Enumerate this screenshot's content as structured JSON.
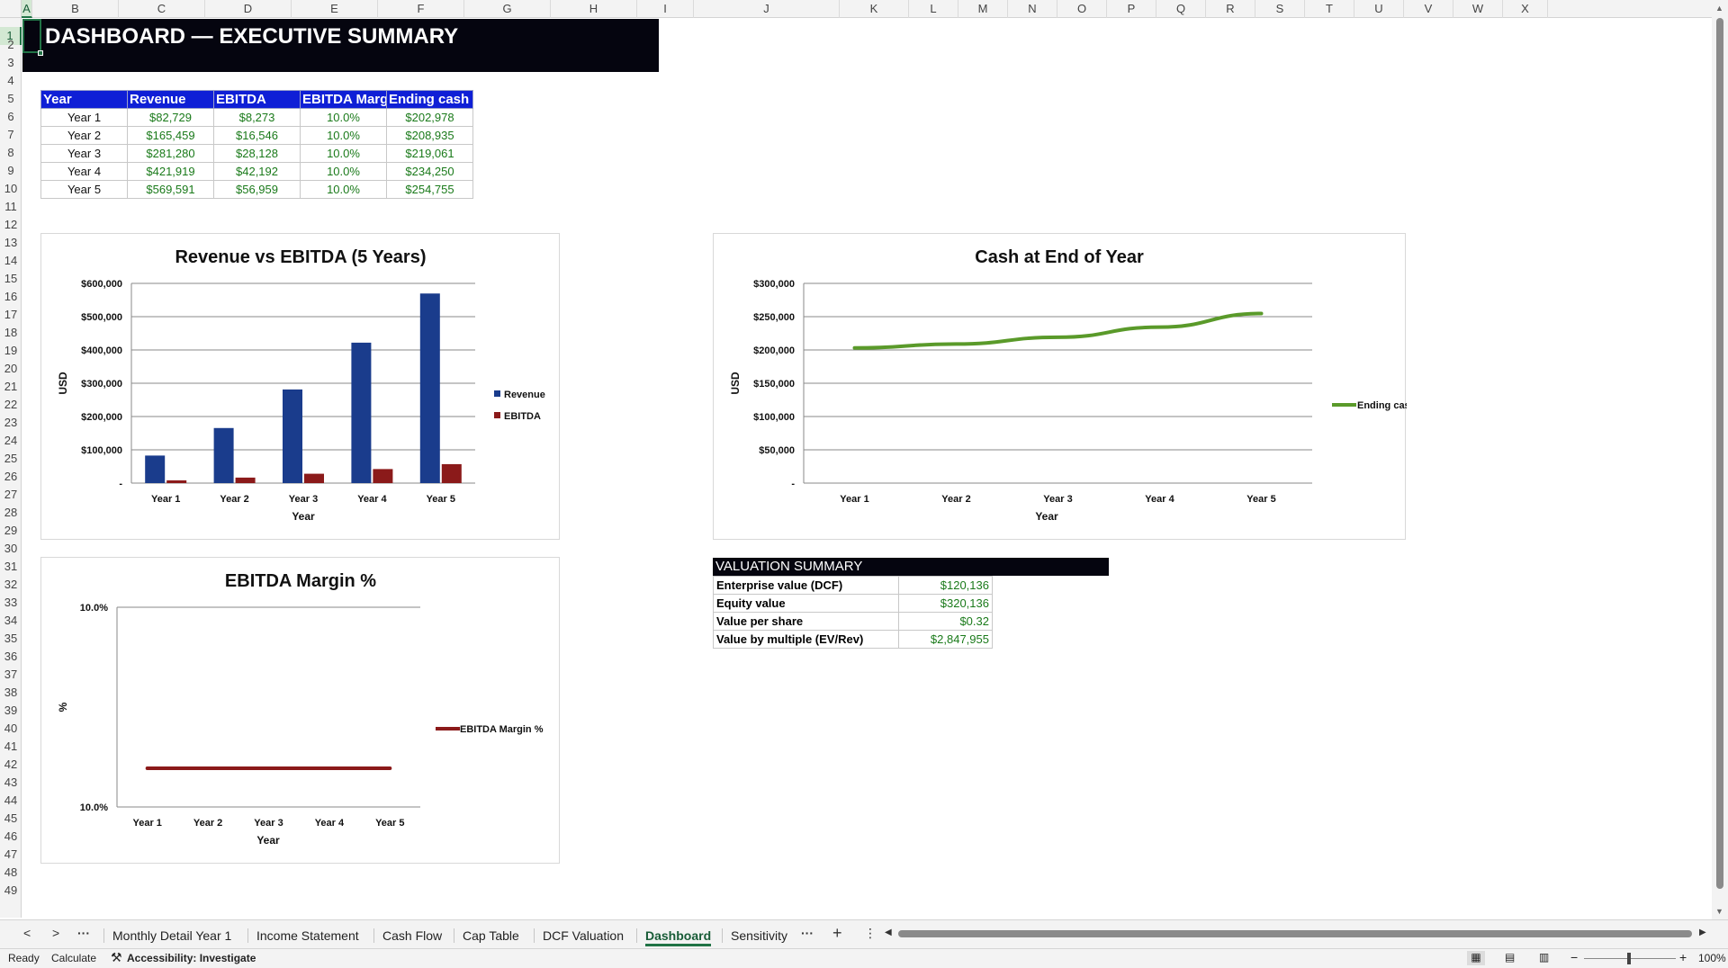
{
  "columns": [
    "A",
    "B",
    "C",
    "D",
    "E",
    "F",
    "G",
    "H",
    "I",
    "J",
    "K",
    "L",
    "M",
    "N",
    "O",
    "P",
    "Q",
    "R",
    "S",
    "T",
    "U",
    "V",
    "W",
    "X"
  ],
  "rows": [
    "1",
    "2",
    "3",
    "4",
    "5",
    "6",
    "7",
    "8",
    "9",
    "10",
    "11",
    "12",
    "13",
    "14",
    "15",
    "16",
    "17",
    "18",
    "19",
    "20",
    "21",
    "22",
    "23",
    "24",
    "25",
    "26",
    "27",
    "28",
    "29",
    "30",
    "31",
    "32",
    "33",
    "34",
    "35",
    "36",
    "37",
    "38",
    "39",
    "40",
    "41",
    "42",
    "43",
    "44",
    "45",
    "46",
    "47",
    "48",
    "49"
  ],
  "title": "DASHBOARD — EXECUTIVE SUMMARY",
  "table": {
    "headers": [
      "Year",
      "Revenue",
      "EBITDA",
      "EBITDA Marg",
      "Ending cash"
    ],
    "rows": [
      [
        "Year 1",
        "$82,729",
        "$8,273",
        "10.0%",
        "$202,978"
      ],
      [
        "Year 2",
        "$165,459",
        "$16,546",
        "10.0%",
        "$208,935"
      ],
      [
        "Year 3",
        "$281,280",
        "$28,128",
        "10.0%",
        "$219,061"
      ],
      [
        "Year 4",
        "$421,919",
        "$42,192",
        "10.0%",
        "$234,250"
      ],
      [
        "Year 5",
        "$569,591",
        "$56,959",
        "10.0%",
        "$254,755"
      ]
    ]
  },
  "colors": {
    "revenue": "#1a3c8c",
    "ebitda": "#8b1a1a",
    "cash": "#5a9a2a",
    "margin": "#8b1a1a",
    "header_blue": "#0f1fd6",
    "green_value": "#1a7a1a"
  },
  "chart_data": [
    {
      "type": "bar",
      "title": "Revenue vs EBITDA (5 Years)",
      "xlabel": "Year",
      "ylabel": "USD",
      "categories": [
        "Year 1",
        "Year 2",
        "Year 3",
        "Year 4",
        "Year 5"
      ],
      "series": [
        {
          "name": "Revenue",
          "values": [
            82729,
            165459,
            281280,
            421919,
            569591
          ]
        },
        {
          "name": "EBITDA",
          "values": [
            8273,
            16546,
            28128,
            42192,
            56959
          ]
        }
      ],
      "ylim": [
        0,
        600000
      ],
      "yticks": [
        "-",
        "$100,000",
        "$200,000",
        "$300,000",
        "$400,000",
        "$500,000",
        "$600,000"
      ],
      "legend": "right"
    },
    {
      "type": "line",
      "title": "Cash at End of Year",
      "xlabel": "Year",
      "ylabel": "USD",
      "categories": [
        "Year 1",
        "Year 2",
        "Year 3",
        "Year 4",
        "Year 5"
      ],
      "series": [
        {
          "name": "Ending cash",
          "values": [
            202978,
            208935,
            219061,
            234250,
            254755
          ]
        }
      ],
      "ylim": [
        0,
        300000
      ],
      "yticks": [
        "-",
        "$50,000",
        "$100,000",
        "$150,000",
        "$200,000",
        "$250,000",
        "$300,000"
      ],
      "legend": "right"
    },
    {
      "type": "line",
      "title": "EBITDA Margin %",
      "xlabel": "Year",
      "ylabel": "%",
      "categories": [
        "Year 1",
        "Year 2",
        "Year 3",
        "Year 4",
        "Year 5"
      ],
      "series": [
        {
          "name": "EBITDA Margin %",
          "values": [
            10.0,
            10.0,
            10.0,
            10.0,
            10.0
          ]
        }
      ],
      "yticks": [
        "10.0%",
        "10.0%"
      ],
      "legend": "right"
    }
  ],
  "valuation": {
    "header": "VALUATION SUMMARY",
    "rows": [
      [
        "Enterprise value (DCF)",
        "$120,136"
      ],
      [
        "Equity value",
        "$320,136"
      ],
      [
        "Value per share",
        "$0.32"
      ],
      [
        "Value by multiple (EV/Rev)",
        "$2,847,955"
      ]
    ]
  },
  "tabs": {
    "nav_prev": "<",
    "nav_next": ">",
    "more_left": "···",
    "sheets": [
      "Monthly Detail Year 1",
      "Income Statement",
      "Cash Flow",
      "Cap Table",
      "DCF Valuation",
      "Dashboard",
      "Sensitivity"
    ],
    "active": "Dashboard",
    "more_right": "···",
    "add": "+",
    "options": "⋮"
  },
  "status": {
    "ready": "Ready",
    "calculate": "Calculate",
    "accessibility": "Accessibility: Investigate",
    "zoom": "100%"
  }
}
